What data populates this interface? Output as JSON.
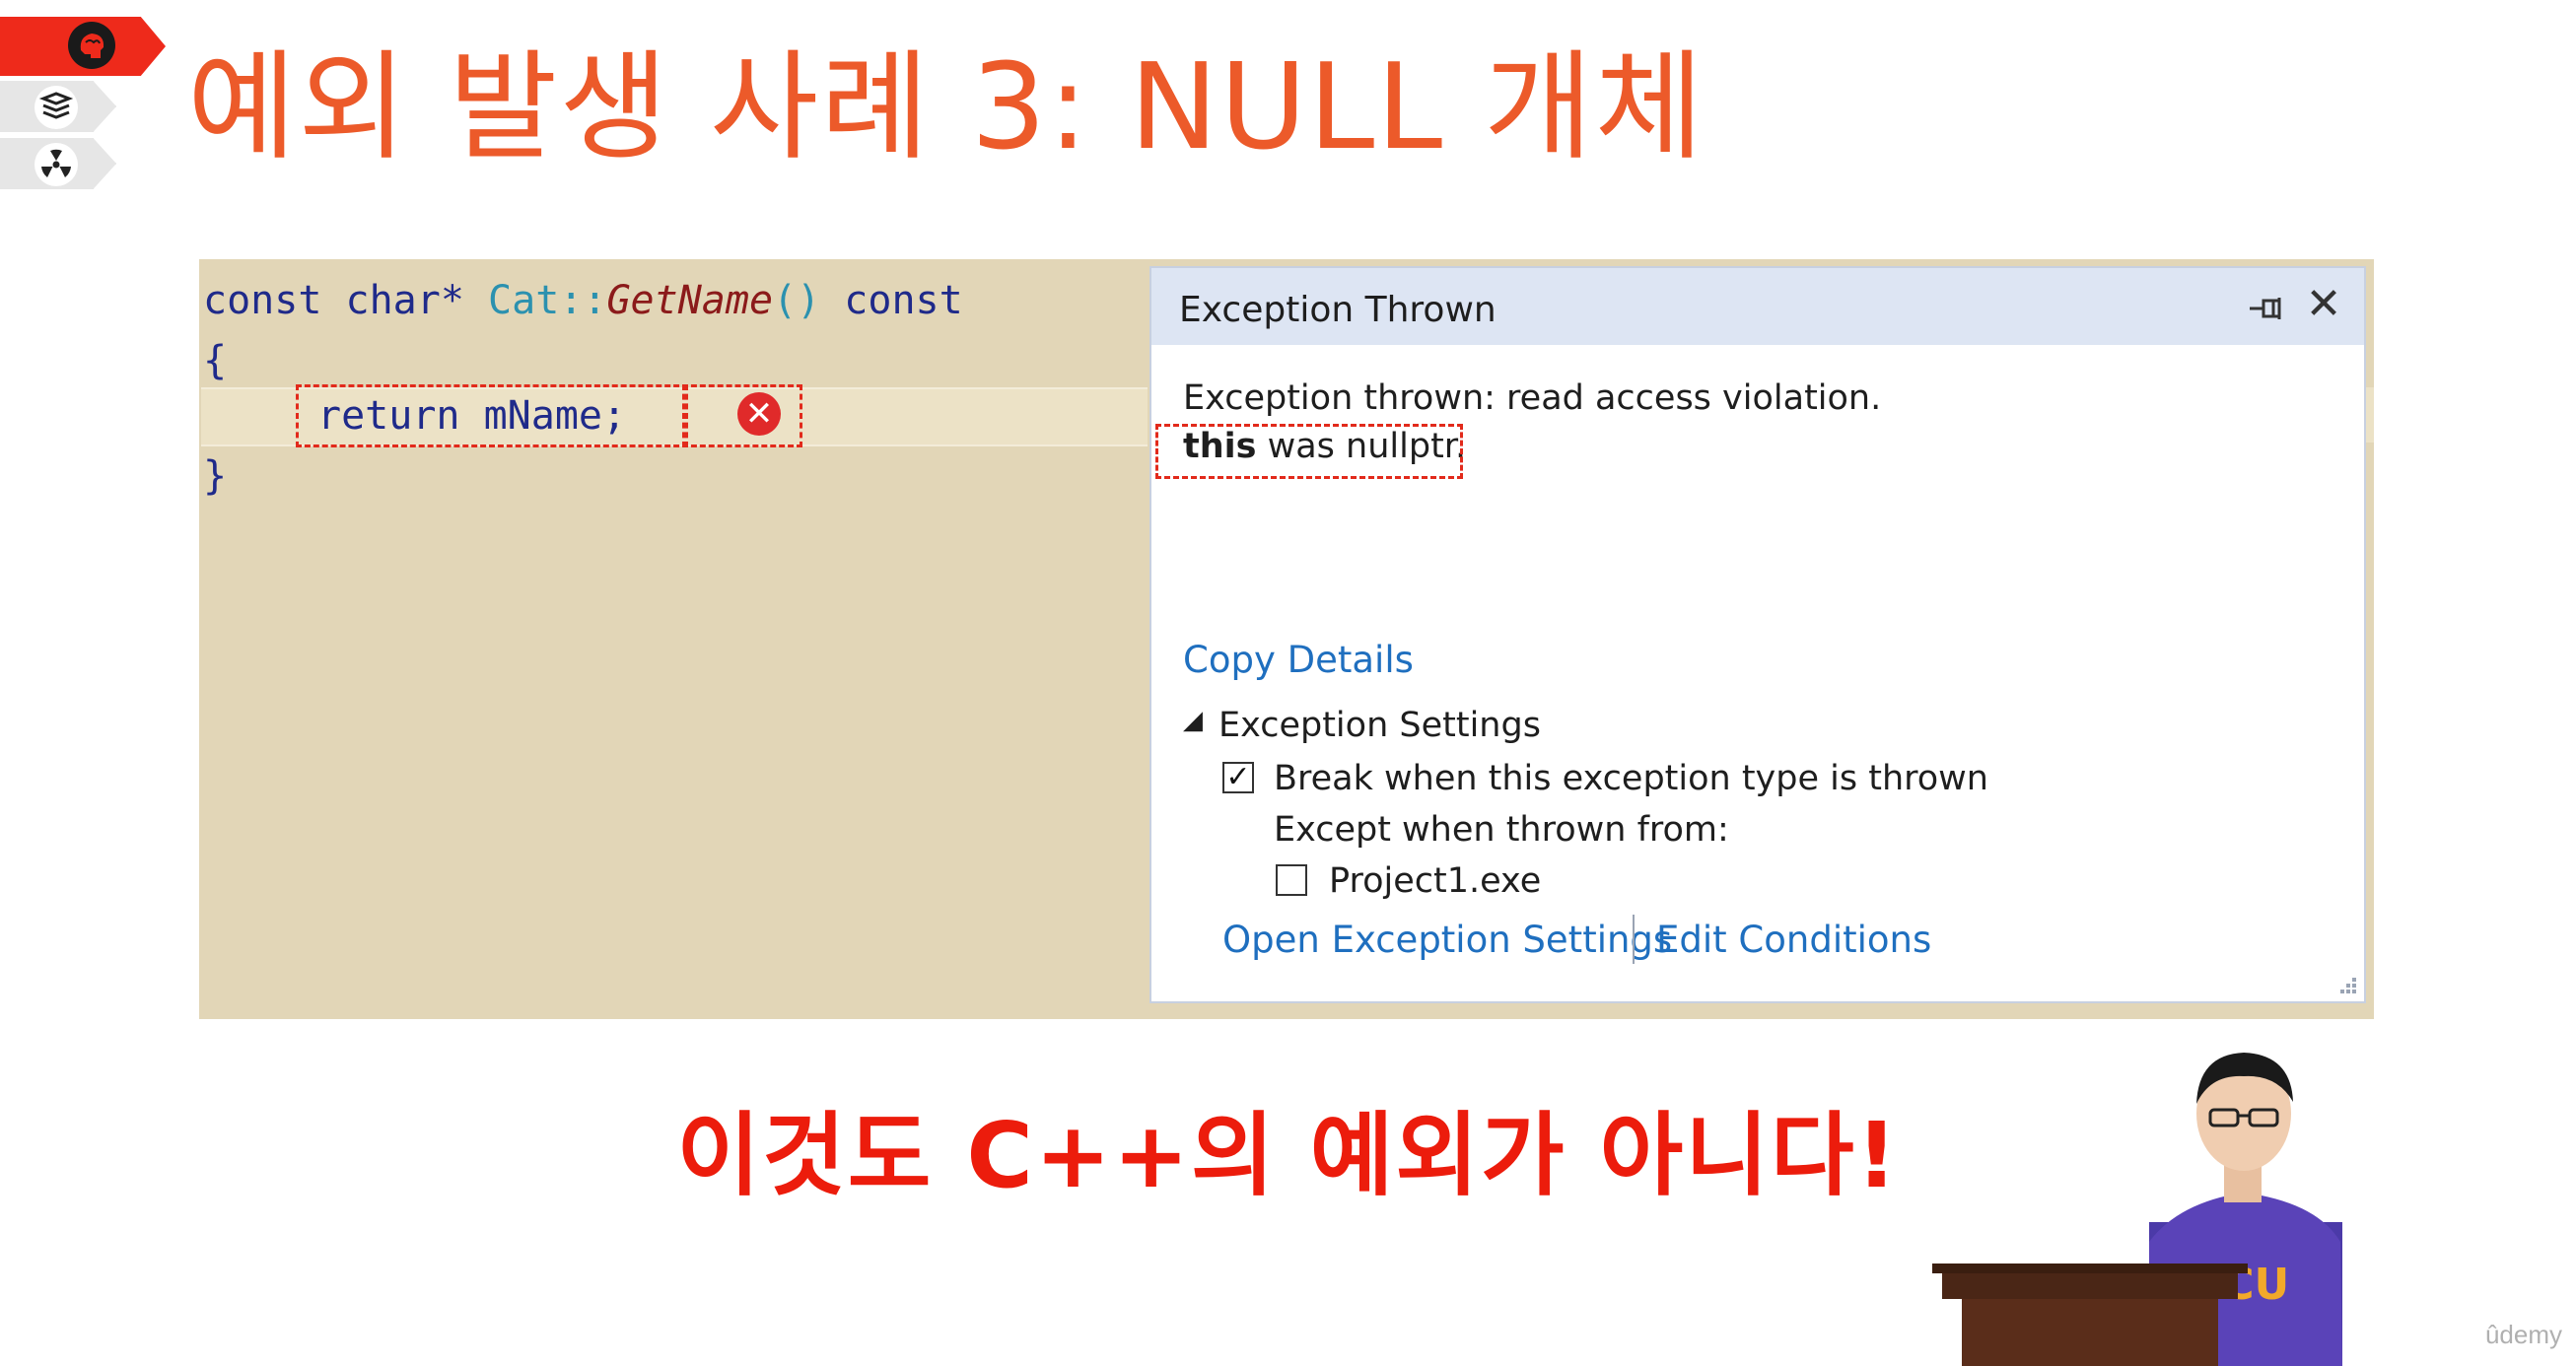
{
  "slide": {
    "title": "예외 발생 사례 3: NULL 개체",
    "caption": "이것도 C++의 예외가 아니다!",
    "watermark": "ûdemy",
    "tabs": [
      "brain-icon",
      "books-icon",
      "radiation-icon"
    ],
    "accent_color": "#ec5a2a",
    "caption_color": "#ec1c0c"
  },
  "code": {
    "line1": {
      "kw1": "const",
      "type": "char*",
      "cls": "Cat::",
      "fn": "GetName",
      "parens": "()",
      "kw2": "const"
    },
    "line2": "{",
    "line3": "return mName;",
    "line4": "}"
  },
  "exception_popup": {
    "title": "Exception Thrown",
    "message_line1": "Exception thrown: read access violation.",
    "message_bold": "this",
    "message_rest": " was nullptr.",
    "copy_details": "Copy Details",
    "settings_header": "Exception Settings",
    "break_label": "Break when this exception type is thrown",
    "break_checked": true,
    "except_label": "Except when thrown from:",
    "project_label": "Project1.exe",
    "project_checked": false,
    "open_settings": "Open Exception Settings",
    "edit_conditions": "Edit Conditions"
  }
}
